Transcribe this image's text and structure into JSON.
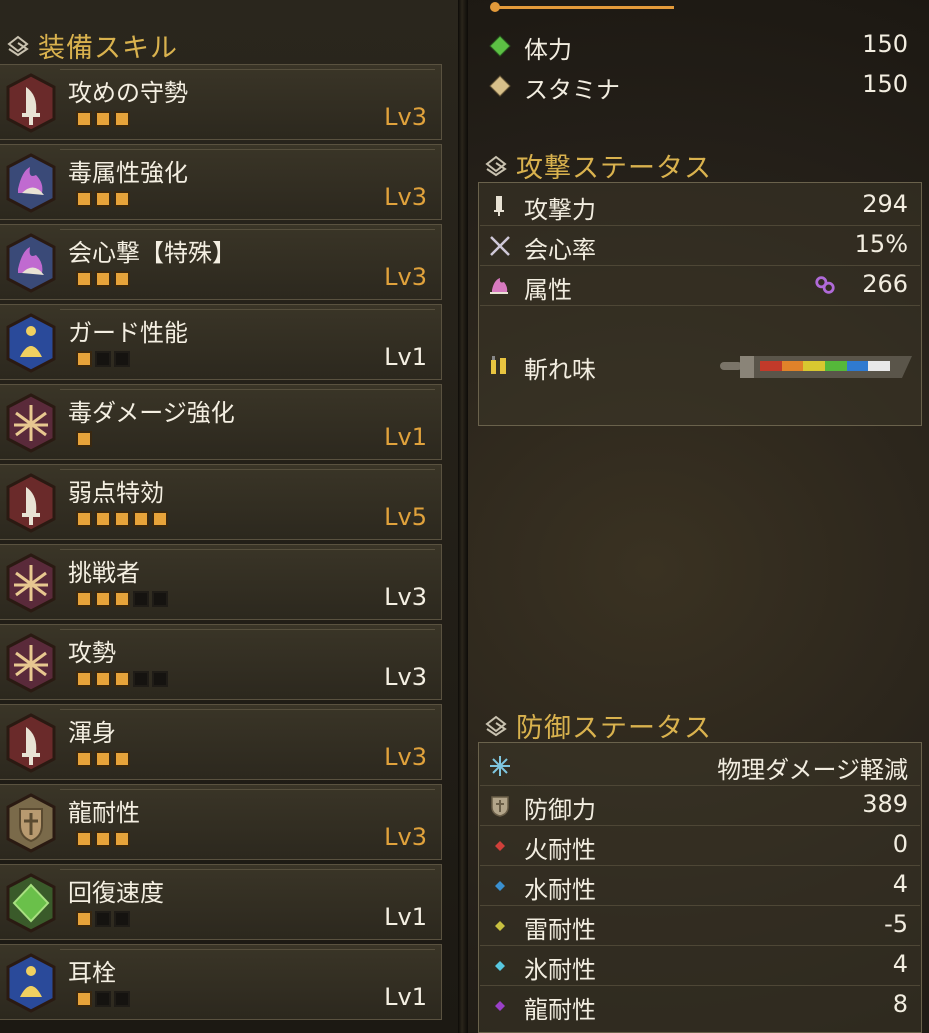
{
  "skills_section": {
    "title": "装備スキル"
  },
  "skills": [
    {
      "name": "攻めの守勢",
      "filled": 3,
      "max": 3,
      "level": "Lv3",
      "icon": "blade-icon",
      "maxed": true
    },
    {
      "name": "毒属性強化",
      "filled": 3,
      "max": 3,
      "level": "Lv3",
      "icon": "flame-blade-icon",
      "maxed": true
    },
    {
      "name": "会心撃【特殊】",
      "filled": 3,
      "max": 3,
      "level": "Lv3",
      "icon": "flame-blade-icon",
      "maxed": true
    },
    {
      "name": "ガード性能",
      "filled": 1,
      "max": 3,
      "level": "Lv1",
      "icon": "meditate-icon",
      "maxed": false
    },
    {
      "name": "毒ダメージ強化",
      "filled": 1,
      "max": 1,
      "level": "Lv1",
      "icon": "burst-icon",
      "maxed": true
    },
    {
      "name": "弱点特効",
      "filled": 5,
      "max": 5,
      "level": "Lv5",
      "icon": "blade-icon",
      "maxed": true
    },
    {
      "name": "挑戦者",
      "filled": 3,
      "max": 5,
      "level": "Lv3",
      "icon": "burst-icon",
      "maxed": false
    },
    {
      "name": "攻勢",
      "filled": 3,
      "max": 5,
      "level": "Lv3",
      "icon": "burst-icon",
      "maxed": false
    },
    {
      "name": "渾身",
      "filled": 3,
      "max": 3,
      "level": "Lv3",
      "icon": "blade-icon",
      "maxed": true
    },
    {
      "name": "龍耐性",
      "filled": 3,
      "max": 3,
      "level": "Lv3",
      "icon": "shield-icon",
      "maxed": true
    },
    {
      "name": "回復速度",
      "filled": 1,
      "max": 3,
      "level": "Lv1",
      "icon": "green-gem-icon",
      "maxed": false
    },
    {
      "name": "耳栓",
      "filled": 1,
      "max": 3,
      "level": "Lv1",
      "icon": "meditate-icon",
      "maxed": false
    }
  ],
  "basic_status": [
    {
      "label": "体力",
      "value": "150",
      "icon": "green-diamond-icon"
    },
    {
      "label": "スタミナ",
      "value": "150",
      "icon": "tan-diamond-icon"
    }
  ],
  "attack_section": {
    "title": "攻撃ステータス"
  },
  "attack_status": [
    {
      "label": "攻撃力",
      "value": "294",
      "icon": "sword-icon"
    },
    {
      "label": "会心率",
      "value": "15%",
      "icon": "crossed-swords-icon"
    },
    {
      "label": "属性",
      "value": "266",
      "icon": "element-icon",
      "sub_icon": "poison-element-icon"
    }
  ],
  "sharpness": {
    "label": "斬れ味",
    "icon": "sharpness-icon",
    "colors": [
      "#c23a2a",
      "#e0822a",
      "#d8c830",
      "#55b83a",
      "#2f7ad0",
      "#e8e8e8"
    ]
  },
  "defense_section": {
    "title": "防御ステータス"
  },
  "defense_header": {
    "label": "物理ダメージ軽減",
    "icon": "snowflake-icon"
  },
  "defense_status": [
    {
      "label": "防御力",
      "value": "389",
      "icon": "defense-shield-icon",
      "color": "#b3a58a"
    },
    {
      "label": "火耐性",
      "value": "0",
      "icon": "fire-icon",
      "color": "#d0403a"
    },
    {
      "label": "水耐性",
      "value": "4",
      "icon": "water-icon",
      "color": "#3a90d0"
    },
    {
      "label": "雷耐性",
      "value": "-5",
      "icon": "thunder-icon",
      "color": "#c8c040"
    },
    {
      "label": "氷耐性",
      "value": "4",
      "icon": "ice-icon",
      "color": "#58c8e0"
    },
    {
      "label": "龍耐性",
      "value": "8",
      "icon": "dragon-icon",
      "color": "#9a40c8"
    }
  ],
  "colors": {
    "gold": "#d9b24e",
    "level_gold": "#e0a23c",
    "pip_on": "#e7a33a"
  }
}
